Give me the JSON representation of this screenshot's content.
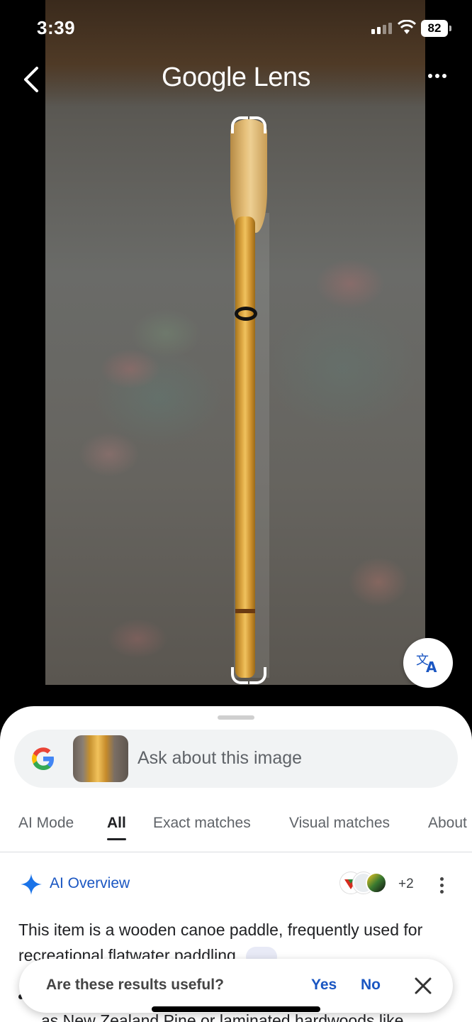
{
  "status_bar": {
    "time": "3:39",
    "battery": "82"
  },
  "header": {
    "title": "Google Lens"
  },
  "icons": {
    "back": "chevron-left-icon",
    "more": "more-horizontal-icon",
    "translate": "translate-icon",
    "google": "google-g-icon",
    "ai": "sparkle-icon",
    "close": "close-icon"
  },
  "search": {
    "placeholder": "Ask about this image"
  },
  "tabs": [
    {
      "label": "AI Mode"
    },
    {
      "label": "All",
      "active": true
    },
    {
      "label": "Exact matches"
    },
    {
      "label": "Visual matches"
    },
    {
      "label": "About"
    }
  ],
  "ai_overview": {
    "label": "AI Overview",
    "sources_more": "+2",
    "paragraph": "This item is a wooden canoe paddle, frequently used for recreational flatwater paddling.",
    "partial_line": "as New Zealand Pine or laminated hardwoods like"
  },
  "feedback": {
    "question": "Are these results useful?",
    "yes": "Yes",
    "no": "No"
  },
  "colors": {
    "accent": "#1a56c2",
    "paddle": "#e0aa45"
  }
}
